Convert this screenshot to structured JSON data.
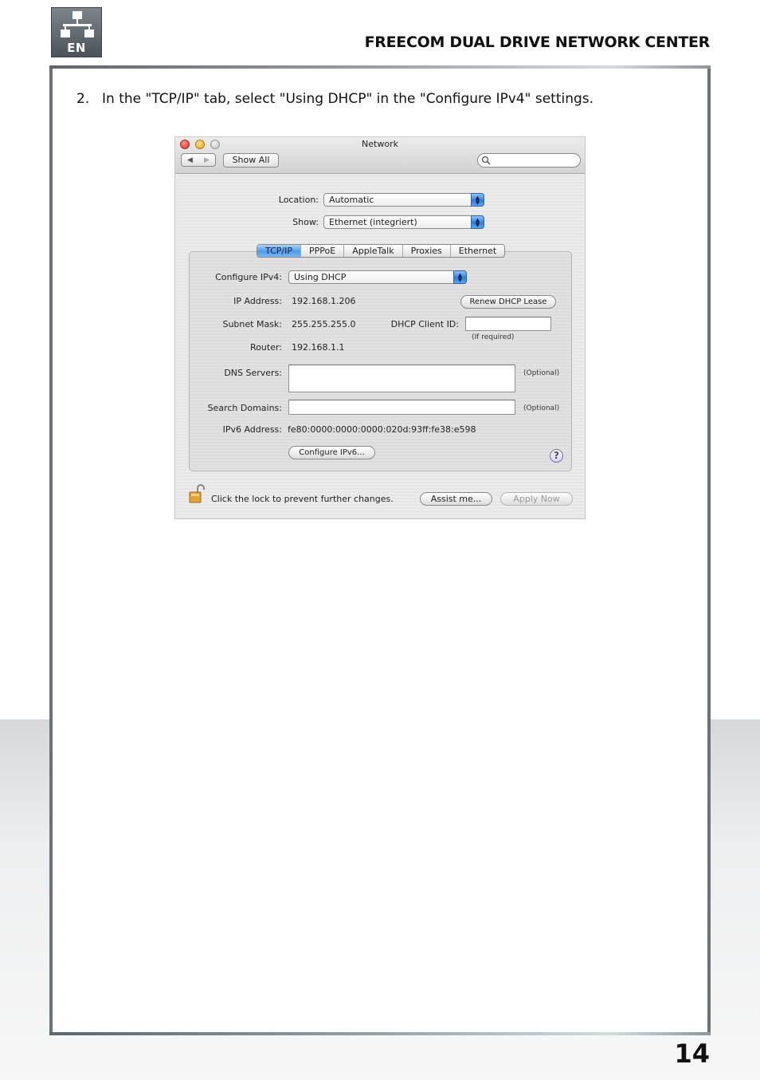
{
  "header": {
    "logo_text": "EN",
    "title": "FREECOM DUAL DRIVE NETWORK CENTER"
  },
  "instruction": {
    "number": "2.",
    "text": "In the \"TCP/IP\" tab, select \"Using DHCP\" in the \"Configure IPv4\" settings."
  },
  "window": {
    "title": "Network",
    "show_all_label": "Show All",
    "nav_back": "◀",
    "nav_forward": "▶",
    "location": {
      "label": "Location:",
      "value": "Automatic"
    },
    "show": {
      "label": "Show:",
      "value": "Ethernet (integriert)"
    },
    "tabs": [
      {
        "label": "TCP/IP",
        "active": true
      },
      {
        "label": "PPPoE",
        "active": false
      },
      {
        "label": "AppleTalk",
        "active": false
      },
      {
        "label": "Proxies",
        "active": false
      },
      {
        "label": "Ethernet",
        "active": false
      }
    ],
    "configure_ipv4": {
      "label": "Configure IPv4:",
      "value": "Using DHCP"
    },
    "ip_address": {
      "label": "IP Address:",
      "value": "192.168.1.206"
    },
    "renew_button": "Renew DHCP Lease",
    "subnet_mask": {
      "label": "Subnet Mask:",
      "value": "255.255.255.0"
    },
    "dhcp_client_id": {
      "label": "DHCP Client ID:",
      "hint": "(If required)"
    },
    "router": {
      "label": "Router:",
      "value": "192.168.1.1"
    },
    "dns_servers": {
      "label": "DNS Servers:",
      "hint": "(Optional)"
    },
    "search_domains": {
      "label": "Search Domains:",
      "hint": "(Optional)"
    },
    "ipv6_address": {
      "label": "IPv6 Address:",
      "value": "fe80:0000:0000:0000:020d:93ff:fe38:e598"
    },
    "configure_ipv6_button": "Configure IPv6...",
    "help_symbol": "?",
    "lock_text": "Click the lock to prevent further changes.",
    "assist_button": "Assist me...",
    "apply_button": "Apply Now"
  },
  "page_number": "14"
}
